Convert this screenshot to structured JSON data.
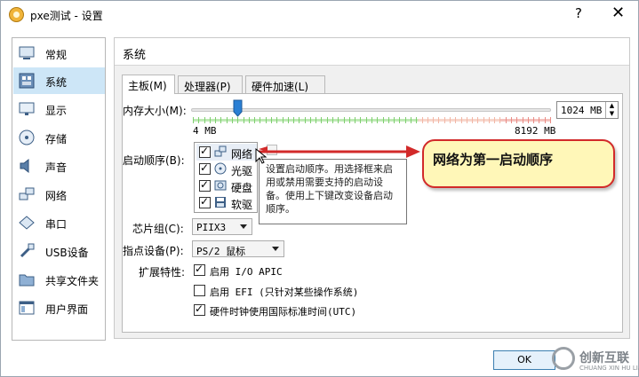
{
  "window": {
    "title": "pxe测试 - 设置",
    "help_label": "?",
    "close_label": "✕"
  },
  "sidebar": {
    "items": [
      {
        "label": "常规",
        "icon": "general-icon"
      },
      {
        "label": "系统",
        "icon": "system-icon",
        "selected": true
      },
      {
        "label": "显示",
        "icon": "display-icon"
      },
      {
        "label": "存储",
        "icon": "storage-icon"
      },
      {
        "label": "声音",
        "icon": "audio-icon"
      },
      {
        "label": "网络",
        "icon": "network-icon"
      },
      {
        "label": "串口",
        "icon": "serial-port-icon"
      },
      {
        "label": "USB设备",
        "icon": "usb-icon"
      },
      {
        "label": "共享文件夹",
        "icon": "shared-folder-icon"
      },
      {
        "label": "用户界面",
        "icon": "user-interface-icon"
      }
    ]
  },
  "page": {
    "title": "系统"
  },
  "tabs": [
    {
      "label": "主板(M)",
      "active": true
    },
    {
      "label": "处理器(P)"
    },
    {
      "label": "硬件加速(L)"
    }
  ],
  "motherboard": {
    "memory_label": "内存大小(M):",
    "memory_value": "1024 MB",
    "memory_min_label": "4 MB",
    "memory_max_label": "8192 MB",
    "memory_fraction": 0.125,
    "boot_order_label": "启动顺序(B):",
    "boot_items": [
      {
        "label": "网络",
        "checked": true,
        "icon": "network-icon"
      },
      {
        "label": "光驱",
        "checked": true,
        "icon": "optical-drive-icon"
      },
      {
        "label": "硬盘",
        "checked": true,
        "icon": "hard-disk-icon"
      },
      {
        "label": "软驱",
        "checked": true,
        "icon": "floppy-icon"
      }
    ],
    "boot_tooltip": "设置启动顺序。用选择框来启用或禁用需要支持的启动设备。使用上下键改变设备启动顺序。",
    "chipset_label": "芯片组(C):",
    "chipset_value": "PIIX3",
    "pointing_label": "指点设备(P):",
    "pointing_value": "PS/2 鼠标",
    "features_label": "扩展特性:",
    "features": [
      {
        "label": "启用 I/O APIC",
        "checked": true
      },
      {
        "label": "启用 EFI (只针对某些操作系统)",
        "checked": false
      },
      {
        "label": "硬件时钟使用国际标准时间(UTC)",
        "checked": true
      }
    ]
  },
  "annotation": {
    "text": "网络为第一启动顺序",
    "color": "#d22a2a"
  },
  "footer": {
    "ok_label": "OK"
  },
  "watermark": {
    "text": "创新互联",
    "sub": "CHUANG XIN HU LIAN"
  }
}
